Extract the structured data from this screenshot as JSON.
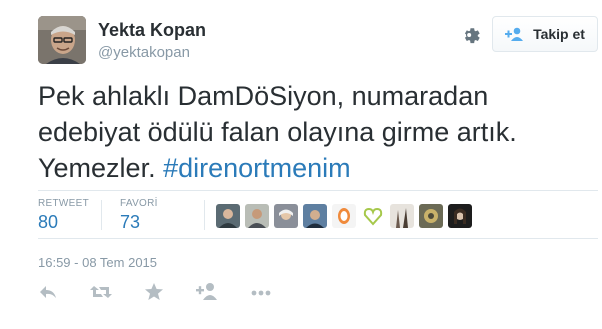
{
  "user": {
    "name": "Yekta Kopan",
    "handle": "@yektakopan"
  },
  "follow_button": {
    "label": "Takip et"
  },
  "tweet": {
    "line1": "Pek ahlaklı DamDöSiyon, numaradan",
    "line2": "edebiyat ödülü falan olayına girme artık.",
    "line3_text": "Yemezler. ",
    "hashtag": "#direnortmenim"
  },
  "stats": {
    "retweet_label": "RETWEET",
    "retweet_count": "80",
    "favorite_label": "FAVORİ",
    "favorite_count": "73"
  },
  "timestamp": "16:59 - 08 Tem 2015",
  "colors": {
    "link": "#2b7bb9",
    "muted": "#8899a6",
    "text": "#292f33",
    "border": "#e1e8ed"
  },
  "favoriters": [
    "avatar-1",
    "avatar-2",
    "avatar-3",
    "avatar-4",
    "avatar-5",
    "avatar-6",
    "avatar-7",
    "avatar-8",
    "avatar-9"
  ],
  "actions": [
    "reply-icon",
    "retweet-icon",
    "favorite-icon",
    "follow-icon",
    "more-icon"
  ]
}
